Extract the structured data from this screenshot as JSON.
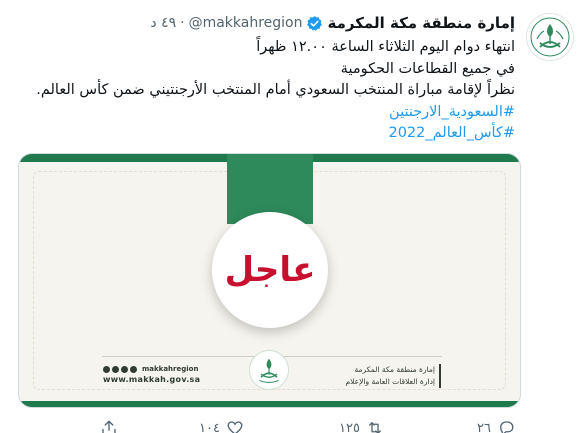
{
  "tweet": {
    "display_name": "إمارة منطقة مكة المكرمة",
    "handle": "@makkahregion",
    "separator": "·",
    "time": "٤٩ د",
    "lines": [
      "انتهاء دوام اليوم الثلاثاء الساعة ١٢.٠٠ ظهراً",
      "في جميع القطاعات الحكومية",
      "نظراً لإقامة مباراة المنتخب السعودي أمام المنتخب الأرجنتيني ضمن كأس العالم."
    ],
    "hashtags": [
      "#السعودية_الارجنتين",
      "#كأس_العالم_2022"
    ]
  },
  "media": {
    "badge_text": "عاجل",
    "social_handle": "makkahregion",
    "site_url": "www.makkah.gov.sa",
    "org_name": "إمارة منطقة مكة المكرمة",
    "dept_name": "إدارة العلاقات العامة والإعلام"
  },
  "actions": {
    "reply_count": "٢٦",
    "retweet_count": "١٢٥",
    "like_count": "١٠٤"
  },
  "colors": {
    "brand_green": "#1f7a4d",
    "badge_red": "#c8102e",
    "link_blue": "#1d9bf0",
    "verified_blue": "#1d9bf0"
  },
  "icons": [
    "emblem-icon",
    "verified-badge-icon",
    "reply-icon",
    "retweet-icon",
    "like-icon",
    "share-icon"
  ]
}
